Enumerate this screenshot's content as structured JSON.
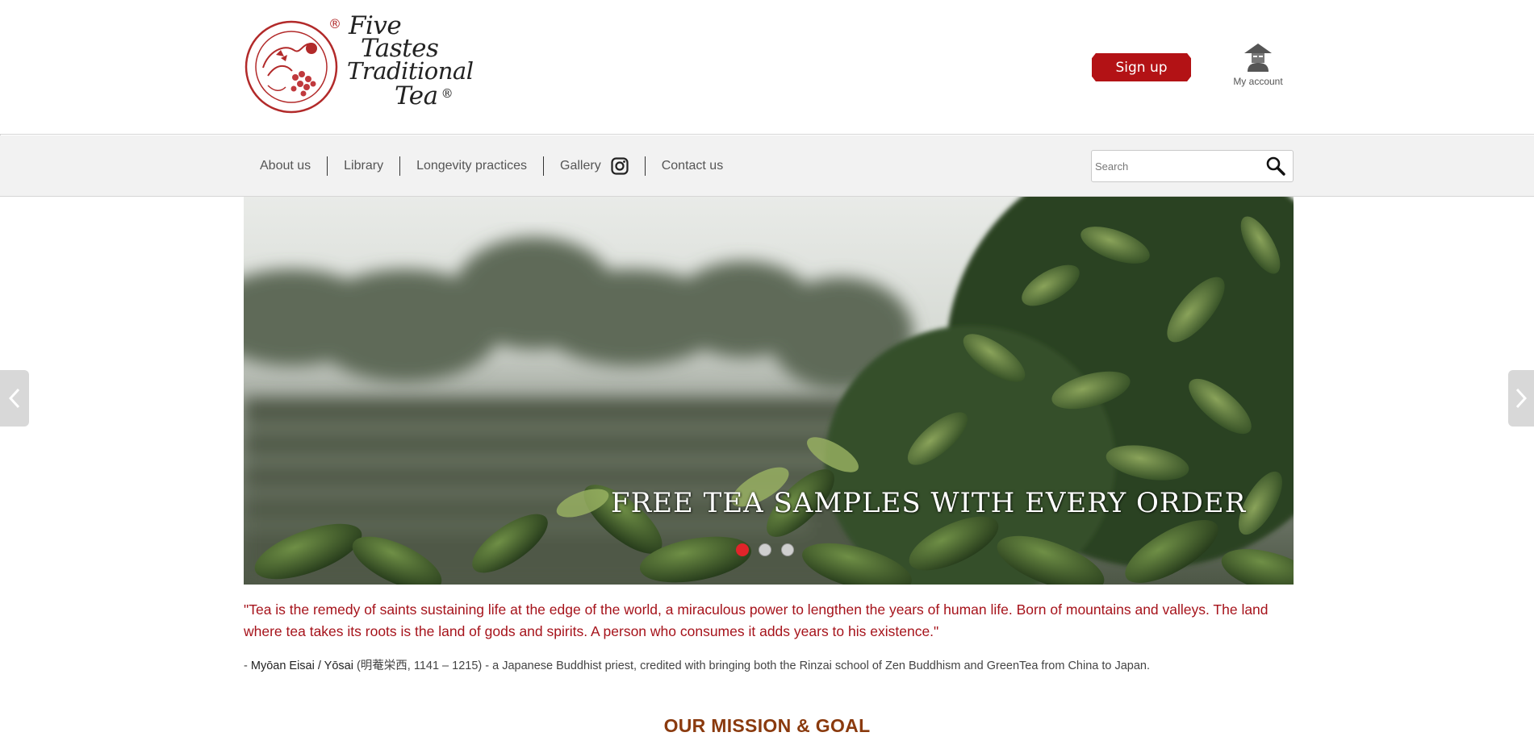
{
  "header": {
    "logo": {
      "words": [
        "Five",
        "Tastes",
        "Traditional",
        "Tea"
      ],
      "registered_mark": "®",
      "emblem_text": "FIVE TASTES TRADITIONAL TEA"
    },
    "signup_label": "Sign up",
    "account_label": "My account"
  },
  "nav": {
    "items": [
      {
        "label": "About us"
      },
      {
        "label": "Library"
      },
      {
        "label": "Longevity practices"
      },
      {
        "label": "Gallery"
      },
      {
        "label": "Contact us"
      }
    ],
    "gallery_icon": "instagram-icon"
  },
  "search": {
    "placeholder": "Search",
    "value": "",
    "icon": "search-icon"
  },
  "slider": {
    "caption": "FREE TEA SAMPLES WITH EVERY ORDER",
    "slide_count": 3,
    "active_slide": 1,
    "prev_icon": "chevron-left-icon",
    "next_icon": "chevron-right-icon"
  },
  "quote": {
    "text": "\"Tea is the remedy of saints sustaining life at the edge of the world, a miraculous power to lengthen the years of human life. Born of mountains and valleys. The land where tea takes its roots is the land of gods and spirits. A person who consumes it adds years to his existence.\"",
    "attribution_prefix": "- ",
    "attribution_name": "Myōan Eisai / Yōsai",
    "attribution_rest": " (明菴栄西, 1141 – 1215) - a Japanese Buddhist priest, credited with bringing both the Rinzai school of Zen Buddhism and GreenTea from China to Japan."
  },
  "mission_heading": "OUR MISSION & GOAL",
  "colors": {
    "brand_red": "#b31215",
    "quote_red": "#a6131b",
    "mission_brown": "#8a3a0e",
    "nav_bg": "#f2f2f2",
    "dot_active": "#e0242a"
  }
}
